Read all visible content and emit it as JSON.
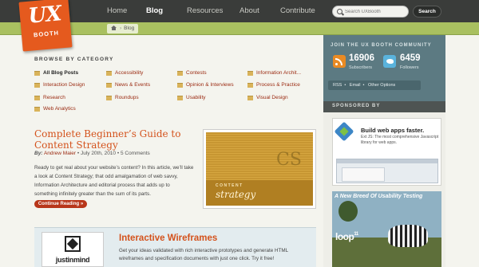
{
  "logo": {
    "line1": "UX",
    "line2": "BOOTH"
  },
  "nav": {
    "links": [
      {
        "label": "Home",
        "active": false
      },
      {
        "label": "Blog",
        "active": true
      },
      {
        "label": "Resources",
        "active": false
      },
      {
        "label": "About",
        "active": false
      },
      {
        "label": "Contribute",
        "active": false
      }
    ],
    "search_placeholder": "Search UXBooth",
    "search_button": "Search"
  },
  "breadcrumb": {
    "current": "Blog"
  },
  "browse": {
    "heading": "BROWSE BY CATEGORY",
    "categories": [
      "All Blog Posts",
      "Accessibility",
      "Contests",
      "Information Archit...",
      "Interaction Design",
      "News & Events",
      "Opinion & Interviews",
      "Process & Practice",
      "Research",
      "Roundups",
      "Usability",
      "Visual Design",
      "Web Analytics"
    ]
  },
  "article": {
    "title": "Complete Beginner’s Guide to Content Strategy",
    "by": "By:",
    "author": "Andrew Maier",
    "date": "July 20th, 2010",
    "comments": "5 Comments",
    "excerpt": "Ready to get real about your website’s content? In this article, we’ll take a look at Content Strategy; that odd amalgamation of web savvy, Information Architecture and editorial process that adds up to something infinitely greater than the sum of its parts.",
    "continue_label": "Continue Reading »",
    "thumb": {
      "watermark": "CS",
      "kicker": "CONTENT",
      "word": "strategy"
    }
  },
  "promo": {
    "brand": "justinmind",
    "title": "Interactive Wireframes",
    "text": "Get your ideas validated with rich interactive prototypes and generate HTML wireframes and specification documents with just one click. Try it free!"
  },
  "community": {
    "title": "JOIN THE UX BOOTH COMMUNITY",
    "subscribers": "16906",
    "subscribers_label": "Subscribers",
    "followers": "6459",
    "followers_label": "Followers",
    "links": [
      "RSS",
      "Email",
      "Other Options"
    ],
    "separator": "•"
  },
  "sponsored": {
    "title": "SPONSORED BY",
    "ad1": {
      "title": "Build web apps faster.",
      "text": "Ext JS: The most comprehensive Javascript library for web apps."
    },
    "ad2": {
      "headline": "A New Breed Of Usability Testing",
      "logo": "loop",
      "logo_sup": "11"
    }
  },
  "colors": {
    "brand_orange": "#e55a1e",
    "nav_bg": "#3a3c3a",
    "green_band": "#a9c060",
    "link_red": "#9b2b12",
    "title_orange": "#d4521c",
    "sidebar_teal": "#5c7a82"
  },
  "icons": [
    "home-icon",
    "search-icon",
    "folder-icon",
    "rss-icon",
    "twitter-icon"
  ]
}
